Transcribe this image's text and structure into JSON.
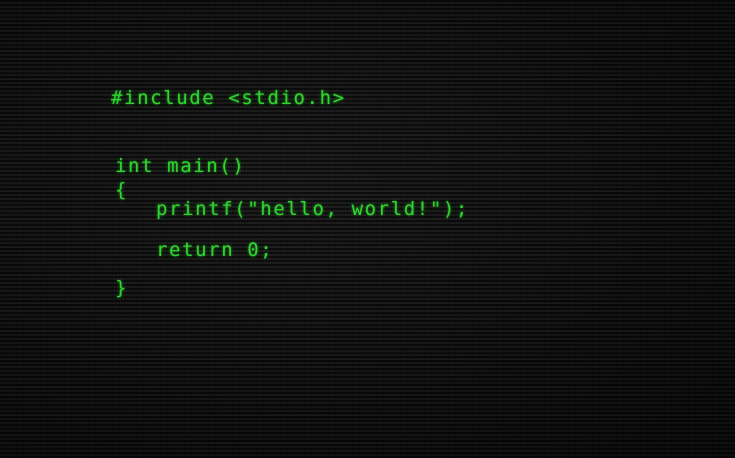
{
  "code": {
    "include": "#include <stdio.h>",
    "main_signature": "int main()",
    "open_brace": "{",
    "printf_line": "printf(\"hello, world!\");",
    "return_line": "return 0;",
    "close_brace": "}"
  },
  "colors": {
    "text": "#2fd52f",
    "background": "#0c0c0c"
  }
}
